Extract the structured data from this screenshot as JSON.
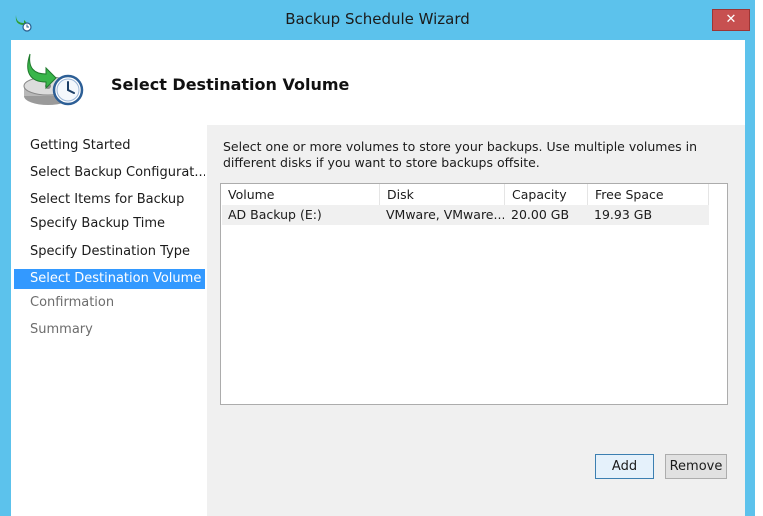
{
  "window": {
    "title": "Backup Schedule Wizard",
    "close_glyph": "✕",
    "accent_color": "#5cc2ec"
  },
  "header": {
    "title": "Select Destination Volume",
    "icon": "backup-schedule-icon"
  },
  "nav": {
    "items": [
      {
        "label": "Getting Started",
        "state": "normal"
      },
      {
        "label": "Select Backup Configurat...",
        "state": "normal"
      },
      {
        "label": "Select Items for Backup",
        "state": "normal"
      },
      {
        "label": "Specify Backup Time",
        "state": "normal"
      },
      {
        "label": "Specify Destination Type",
        "state": "normal"
      },
      {
        "label": "Select Destination Volume",
        "state": "selected"
      },
      {
        "label": "Confirmation",
        "state": "disabled"
      },
      {
        "label": "Summary",
        "state": "disabled"
      }
    ],
    "selected_color": "#3399ff"
  },
  "main": {
    "instructions": "Select one or more volumes to store your backups. Use multiple volumes in different disks if you want to store backups offsite.",
    "table": {
      "columns": [
        "Volume",
        "Disk",
        "Capacity",
        "Free Space"
      ],
      "rows": [
        [
          "AD Backup (E:)",
          "VMware, VMware...",
          "20.00 GB",
          "19.93 GB"
        ]
      ]
    },
    "add_label": "Add",
    "remove_label": "Remove"
  }
}
